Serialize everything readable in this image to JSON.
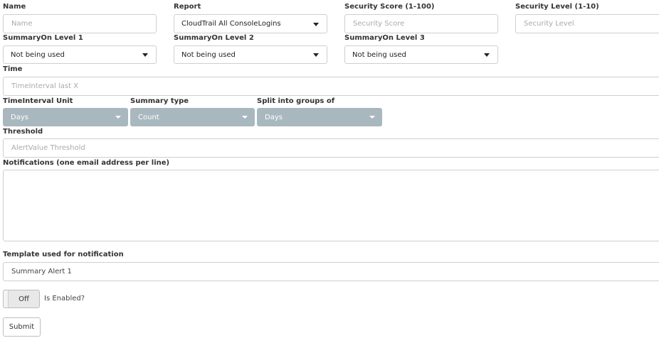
{
  "fields": {
    "name": {
      "label": "Name",
      "placeholder": "Name"
    },
    "report": {
      "label": "Report",
      "value": "CloudTrail All ConsoleLogins"
    },
    "security_score": {
      "label": "Security Score (1-100)",
      "placeholder": "Security Score"
    },
    "security_level": {
      "label": "Security Level (1-10)",
      "placeholder": "Security Level"
    },
    "summary_on_1": {
      "label": "SummaryOn Level 1",
      "value": "Not being used"
    },
    "summary_on_2": {
      "label": "SummaryOn Level 2",
      "value": "Not being used"
    },
    "summary_on_3": {
      "label": "SummaryOn Level 3",
      "value": "Not being used"
    },
    "time": {
      "label": "Time",
      "placeholder": "TimeInterval last X"
    },
    "time_unit": {
      "label": "TimeInterval Unit",
      "value": "Days"
    },
    "summary_type": {
      "label": "Summary type",
      "value": "Count"
    },
    "split_groups": {
      "label": "Split into groups of",
      "value": "Days"
    },
    "threshold": {
      "label": "Threshold",
      "placeholder": "AlertValue Threshold"
    },
    "notifications": {
      "label": "Notifications (one email address per line)",
      "value": ""
    },
    "template": {
      "label": "Template used for notification",
      "value": "Summary Alert 1"
    },
    "enabled": {
      "toggle_label": "Off",
      "label": "Is Enabled?"
    },
    "submit": {
      "label": "Submit"
    }
  },
  "colors": {
    "gray_select": "#a9b8bf",
    "border": "#cfcfcf"
  }
}
